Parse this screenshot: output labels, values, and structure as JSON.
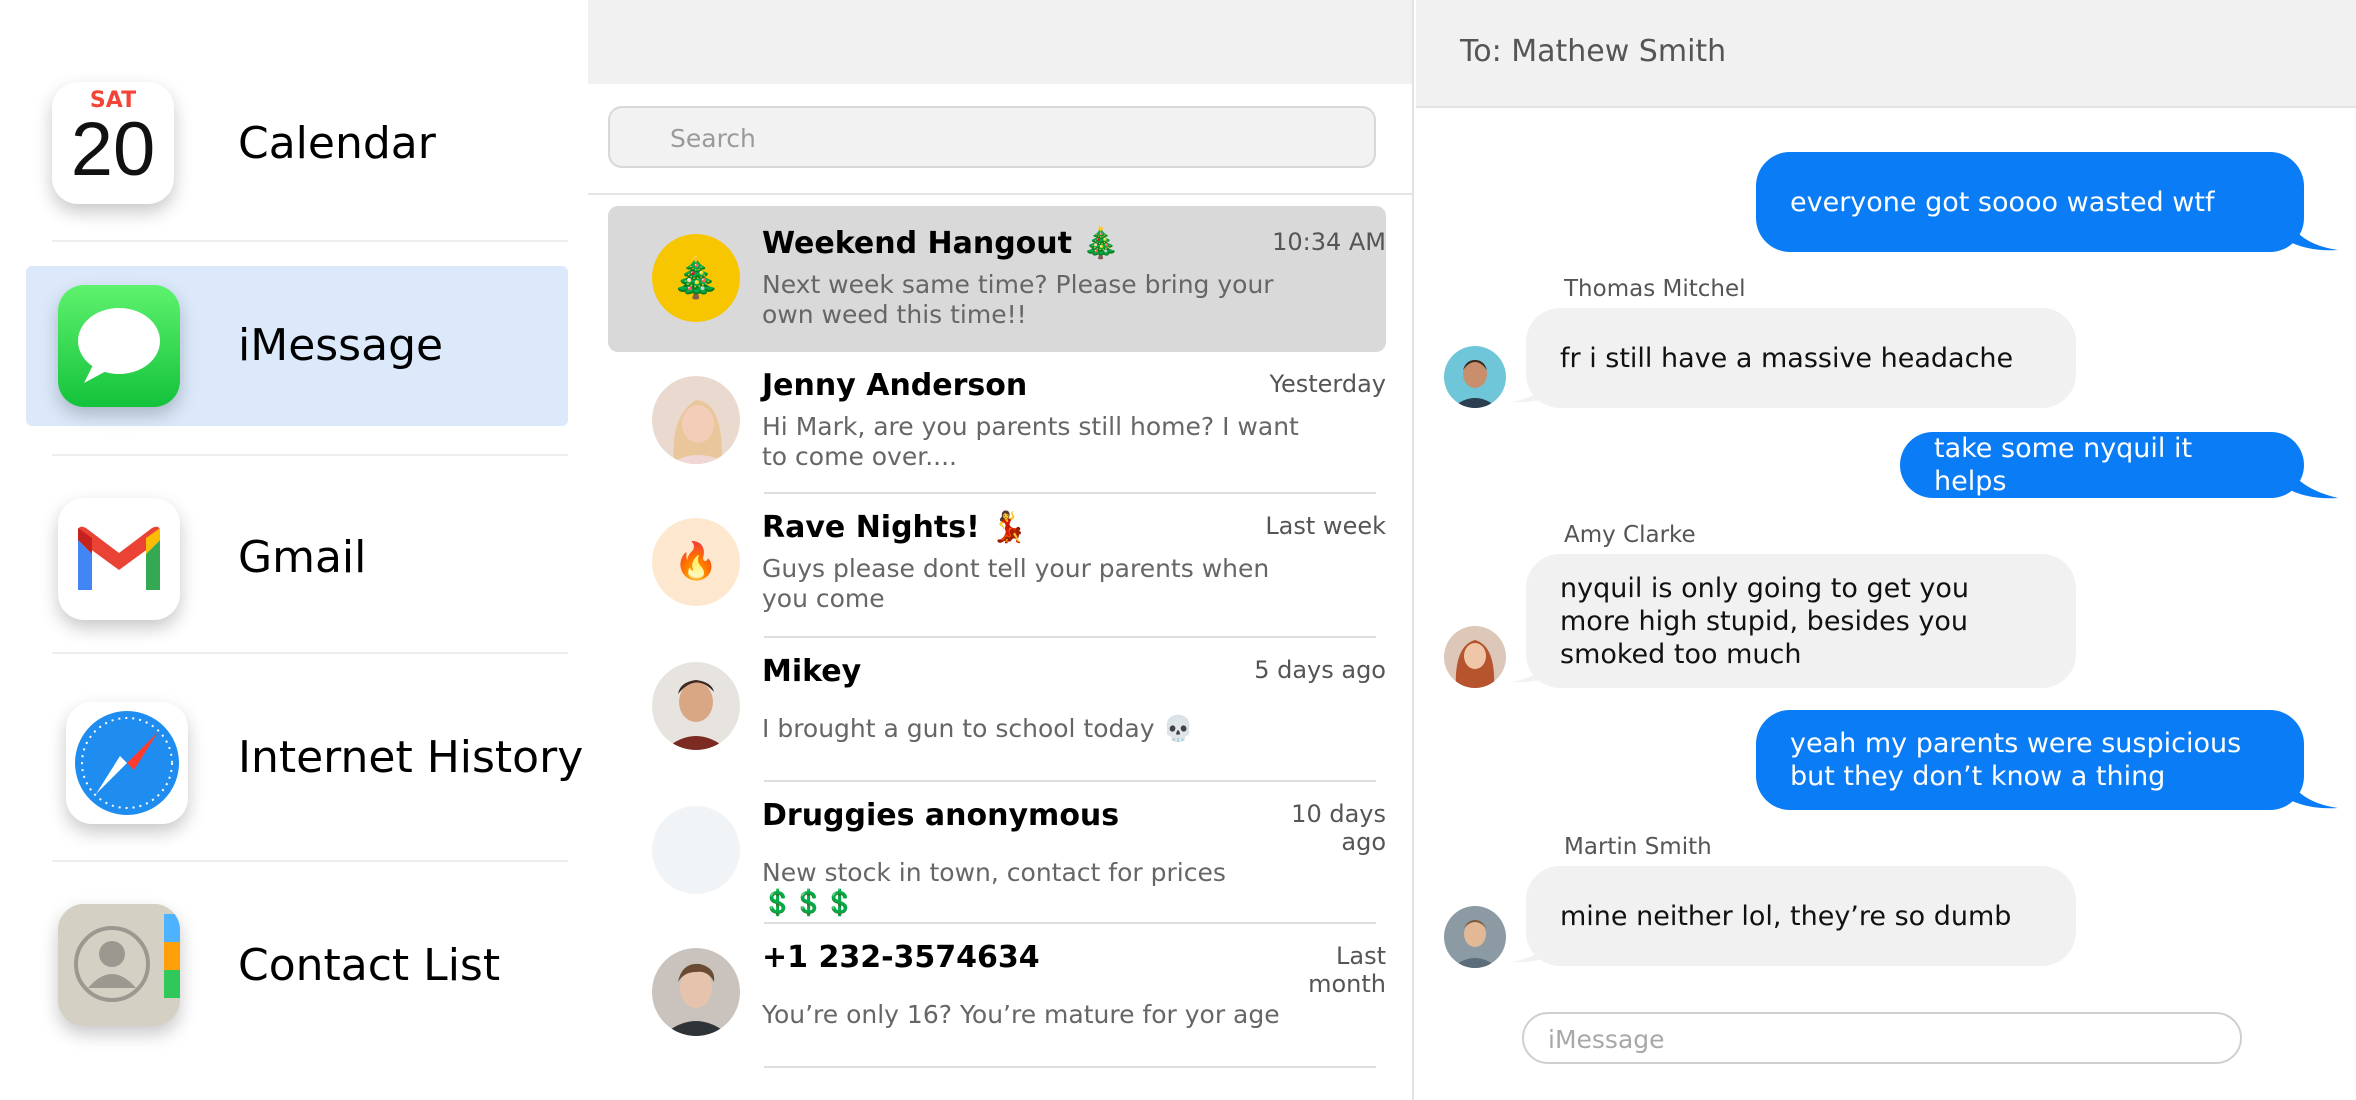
{
  "apps": {
    "calendar": {
      "label": "Calendar",
      "day_of_week": "SAT",
      "day": "20"
    },
    "imessage": {
      "label": "iMessage"
    },
    "gmail": {
      "label": "Gmail"
    },
    "internet_history": {
      "label": "Internet History"
    },
    "contacts": {
      "label": "Contact List"
    },
    "selected": "iMessage"
  },
  "search": {
    "placeholder": "Search"
  },
  "conversations": [
    {
      "name": "Weekend Hangout 🎄",
      "time": "10:34 AM",
      "preview": "Next week same time? Please bring your own weed this time!!",
      "avatar_emoji": "🎄",
      "avatar_color": "#f7c600"
    },
    {
      "name": "Jenny Anderson",
      "time": "Yesterday",
      "preview": "Hi Mark, are you parents still home? I want to come over...."
    },
    {
      "name": "Rave Nights! 💃",
      "time": "Last week",
      "preview": "Guys please dont tell your parents when you come",
      "avatar_emoji": "🔥",
      "avatar_color": "#fde8cf"
    },
    {
      "name": "Mikey",
      "time": "5 days ago",
      "preview": "I brought a gun to school today 💀"
    },
    {
      "name": "Druggies anonymous",
      "time": "10 days ago",
      "preview": "New stock in town, contact for prices 💲💲💲",
      "avatar_color": "#f1f4f7"
    },
    {
      "name": "+1 232-3574634",
      "time": "Last month",
      "preview": "You’re only 16? You’re mature for yor age"
    }
  ],
  "chat": {
    "to_label": "To: Mathew Smith",
    "messages": [
      {
        "direction": "out",
        "text": "everyone got soooo wasted wtf"
      },
      {
        "direction": "in",
        "sender": "Thomas Mitchel",
        "text": "fr i still have a massive headache"
      },
      {
        "direction": "out",
        "text": "take some nyquil it helps"
      },
      {
        "direction": "in",
        "sender": "Amy Clarke",
        "text": "nyquil is only going to get you more high stupid, besides you smoked too much"
      },
      {
        "direction": "out",
        "text": "yeah my parents were suspicious but they don’t know a thing"
      },
      {
        "direction": "in",
        "sender": "Martin Smith",
        "text": "mine neither lol, they’re so dumb"
      }
    ],
    "compose_placeholder": "iMessage"
  },
  "colors": {
    "outgoing_bubble": "#0a7cf5",
    "incoming_bubble": "#f1f1f1",
    "selected_app": "#dbe9fb",
    "selected_convo": "#d9d9d9"
  }
}
